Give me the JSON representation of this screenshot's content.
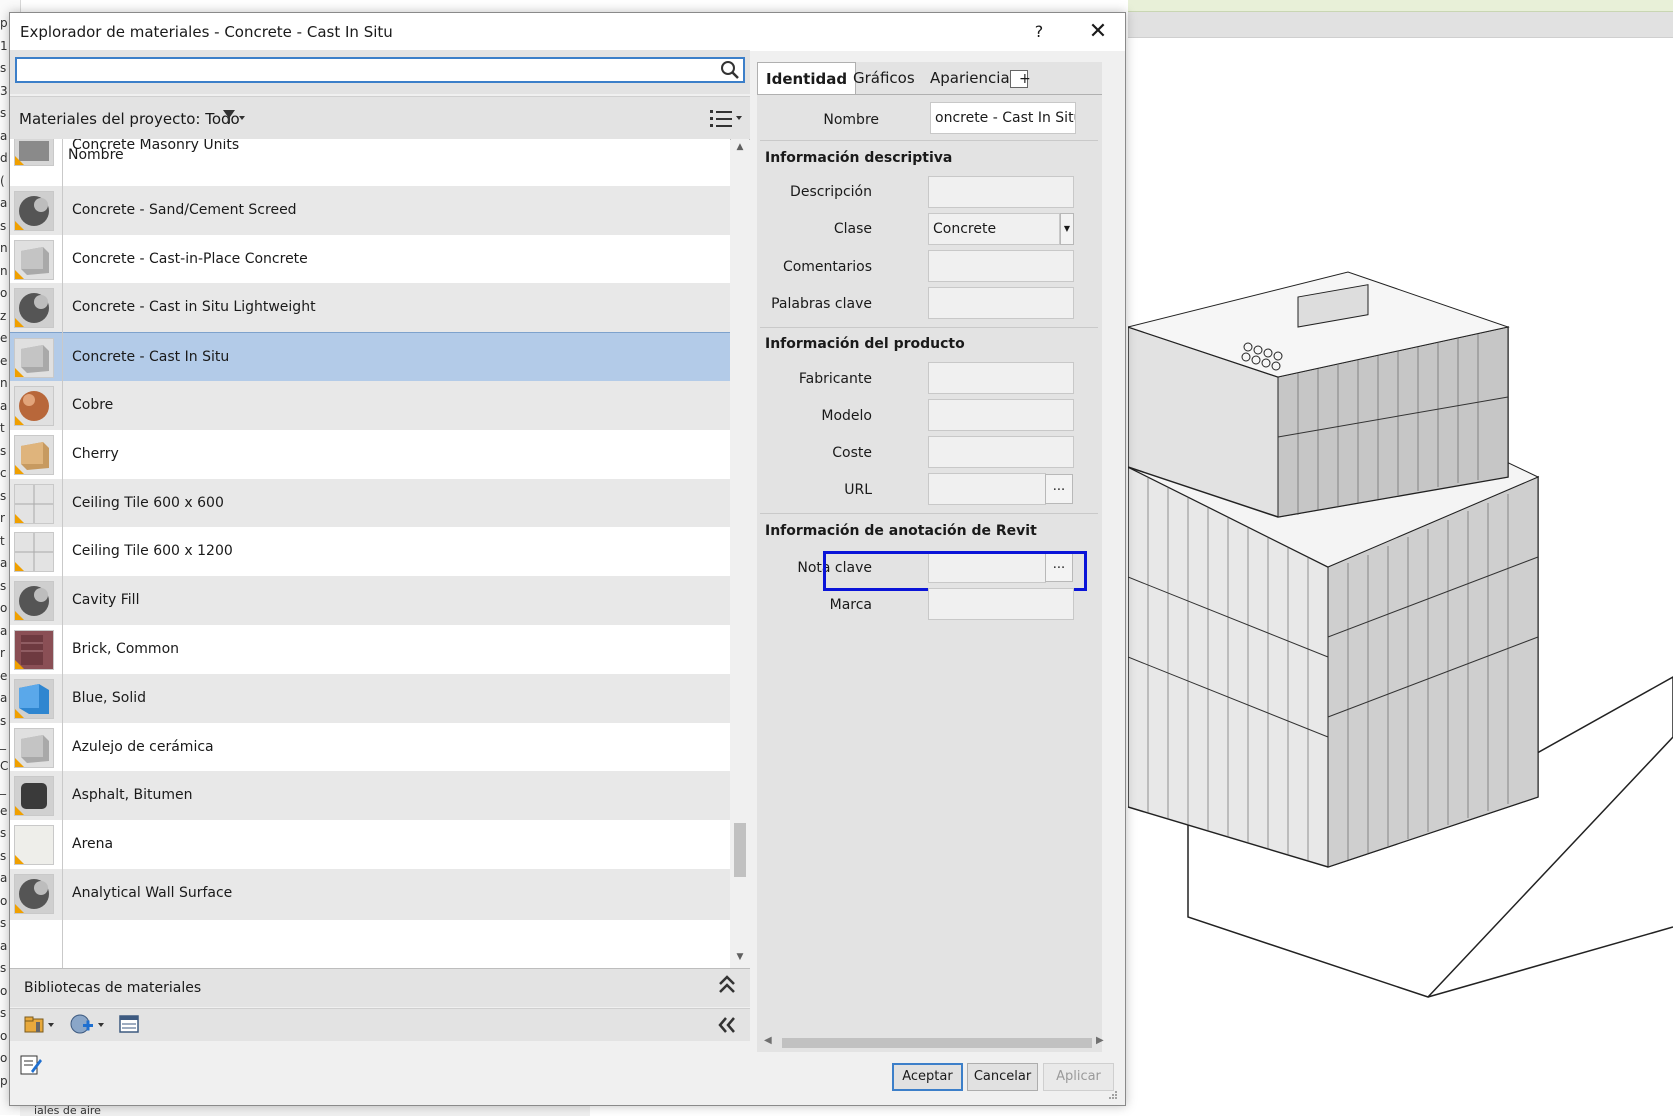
{
  "dialog": {
    "title": "Explorador de materiales - Concrete - Cast In Situ",
    "help": "?",
    "close": "✕"
  },
  "left": {
    "search_value": "",
    "filter_label": "Materiales del proyecto: Todo",
    "column_header": "Nombre",
    "materials": [
      {
        "name": "Concrete Masonry Units",
        "icon": "masonry-swatch",
        "selected": false
      },
      {
        "name": "Concrete - Sand/Cement Screed",
        "icon": "sphere-swatch",
        "selected": false
      },
      {
        "name": "Concrete - Cast-in-Place Concrete",
        "icon": "cube-swatch",
        "selected": false
      },
      {
        "name": "Concrete - Cast in Situ Lightweight",
        "icon": "sphere-swatch",
        "selected": false
      },
      {
        "name": "Concrete - Cast In Situ",
        "icon": "cube-swatch",
        "selected": true
      },
      {
        "name": "Cobre",
        "icon": "copper-sphere-swatch",
        "selected": false
      },
      {
        "name": "Cherry",
        "icon": "wood-cube-swatch",
        "selected": false
      },
      {
        "name": "Ceiling Tile 600 x 600",
        "icon": "tile-swatch",
        "selected": false
      },
      {
        "name": "Ceiling Tile 600 x 1200",
        "icon": "tile-swatch",
        "selected": false
      },
      {
        "name": "Cavity Fill",
        "icon": "sphere-swatch",
        "selected": false
      },
      {
        "name": "Brick, Common",
        "icon": "brick-swatch",
        "selected": false
      },
      {
        "name": "Blue, Solid",
        "icon": "blue-swatch",
        "selected": false
      },
      {
        "name": "Azulejo de cerámica",
        "icon": "cube-swatch",
        "selected": false
      },
      {
        "name": "Asphalt, Bitumen",
        "icon": "cylinder-swatch",
        "selected": false
      },
      {
        "name": "Arena",
        "icon": "blank-swatch",
        "selected": false
      },
      {
        "name": "Analytical Wall Surface",
        "icon": "sphere-swatch",
        "selected": false
      }
    ],
    "libraries_label": "Bibliotecas de materiales"
  },
  "right": {
    "tabs": [
      "Identidad",
      "Gráficos",
      "Apariencia"
    ],
    "active_tab": "Identidad",
    "add_tab": "+",
    "name_label": "Nombre",
    "name_value": "oncrete - Cast In Situ",
    "descriptive_section": "Información descriptiva",
    "descripcion_label": "Descripción",
    "descripcion_value": "",
    "clase_label": "Clase",
    "clase_value": "Concrete",
    "comentarios_label": "Comentarios",
    "comentarios_value": "",
    "palabras_label": "Palabras clave",
    "palabras_value": "",
    "product_section": "Información del producto",
    "fabricante_label": "Fabricante",
    "fabricante_value": "",
    "modelo_label": "Modelo",
    "modelo_value": "",
    "coste_label": "Coste",
    "coste_value": "",
    "url_label": "URL",
    "url_value": "",
    "url_browse": "...",
    "annotation_section": "Información de anotación de Revit",
    "nota_label": "Nota clave",
    "nota_value": "",
    "nota_browse": "...",
    "marca_label": "Marca",
    "marca_value": ""
  },
  "buttons": {
    "ok": "Aceptar",
    "cancel": "Cancelar",
    "apply": "Aplicar"
  },
  "background": {
    "bottom_text": "iales de aire",
    "left_letters": [
      "p",
      "1",
      "s",
      "3",
      "s",
      "a",
      "d",
      "(",
      "a",
      "s",
      "n",
      "n",
      "o",
      "z",
      "e",
      "e",
      "n",
      "a",
      "t",
      "s",
      "c",
      "s",
      "r",
      "t",
      "a",
      "s",
      "o",
      "a",
      "r",
      "e",
      "a",
      "s",
      "_",
      "C",
      "_",
      "e",
      "s",
      "s",
      "a",
      "o",
      "s",
      "a",
      "s",
      "o",
      "s",
      "o",
      "o",
      "p"
    ],
    "highlight_color": "#0a14d8",
    "accent_color": "#3c7fc9",
    "selection_color": "#b3cbe8"
  }
}
